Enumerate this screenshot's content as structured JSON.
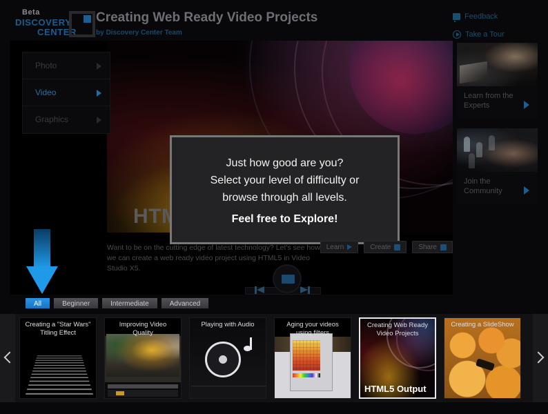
{
  "header": {
    "logo": {
      "beta": "Beta",
      "line1": "DISCOVERY",
      "line2": "CENTER"
    },
    "title": "Creating Web Ready Video Projects",
    "subtitle": "by Discovery Center Team",
    "links": [
      {
        "label": "Feedback",
        "icon": "feedback-icon"
      },
      {
        "label": "Take a Tour",
        "icon": "play-circle-icon"
      }
    ]
  },
  "left_menu": {
    "items": [
      {
        "label": "Photo",
        "active": false
      },
      {
        "label": "Video",
        "active": true
      },
      {
        "label": "Graphics",
        "active": false
      }
    ]
  },
  "stage": {
    "watermark": "HTML5 Output",
    "modal": {
      "line1": "Just how good are you?",
      "line2": "Select your level of difficulty or",
      "line3": "browse through all levels.",
      "bold": "Feel free to Explore!"
    },
    "description": "Want to be on the cutting edge of latest technology? Let's see how we can create a web ready video project using HTML5 in Video Studio X5.",
    "action_buttons": [
      {
        "label": "Learn",
        "icon": "play-triangle-icon"
      },
      {
        "label": "Create",
        "icon": "create-icon"
      },
      {
        "label": "Share",
        "icon": "share-icon"
      }
    ],
    "player": {
      "prev": "previous-icon",
      "next": "next-icon",
      "stop": "stop-icon"
    }
  },
  "right_sidebar": {
    "cards": [
      {
        "label": "Learn from the Experts",
        "art": "expert"
      },
      {
        "label": "Join the Community",
        "art": "comm"
      }
    ]
  },
  "filters": {
    "tabs": [
      {
        "label": "All",
        "active": true
      },
      {
        "label": "Beginner",
        "active": false
      },
      {
        "label": "Intermediate",
        "active": false
      },
      {
        "label": "Advanced",
        "active": false
      }
    ],
    "highlight_arrow_color": "#1f9ae8"
  },
  "carousel": {
    "prev_icon": "chevron-left-icon",
    "next_icon": "chevron-right-icon",
    "cards": [
      {
        "title": "Creating a \"Star Wars\" Titling Effect",
        "art": "starwars",
        "selected": false,
        "overlay": ""
      },
      {
        "title": "Improving Video Quality",
        "art": "quality",
        "selected": false,
        "overlay": ""
      },
      {
        "title": "Playing with Audio",
        "art": "audio",
        "selected": false,
        "overlay": ""
      },
      {
        "title": "Aging your videos using filters",
        "art": "filters",
        "selected": false,
        "overlay": ""
      },
      {
        "title": "Creating Web Ready Video Projects",
        "art": "html5",
        "selected": true,
        "overlay": "HTML5 Output"
      },
      {
        "title": "Creating a SlideShow",
        "art": "slides",
        "selected": false,
        "overlay": ""
      }
    ]
  },
  "colors": {
    "accent_blue": "#1f9ae8",
    "logo_blue": "#1c5d8e",
    "background": "#08080a",
    "modal_bg": "#232325",
    "modal_border": "#787878"
  }
}
